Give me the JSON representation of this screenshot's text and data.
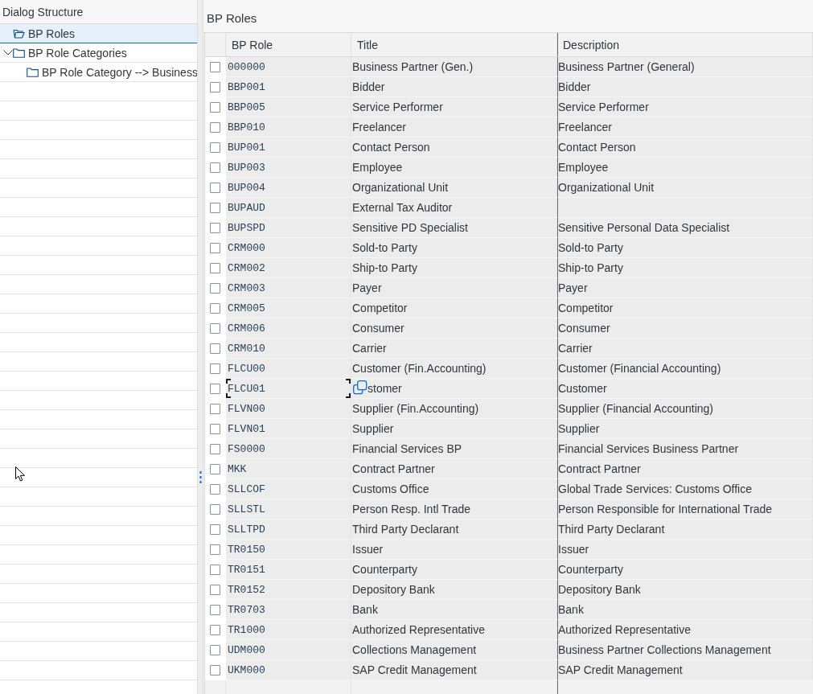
{
  "dialog_structure": {
    "title": "Dialog Structure",
    "items": [
      {
        "label": "BP Roles",
        "selected": true
      },
      {
        "label": "BP Role Categories",
        "selected": false,
        "expanded": true,
        "children": [
          {
            "label": "BP Role Category --> Business",
            "selected": false
          }
        ]
      }
    ]
  },
  "table": {
    "title": "BP Roles",
    "columns": [
      "BP Role",
      "Title",
      "Description"
    ],
    "rows": [
      {
        "role": "000000",
        "title": "Business Partner (Gen.)",
        "description": "Business Partner (General)",
        "selected": false,
        "focused": false
      },
      {
        "role": "BBP001",
        "title": "Bidder",
        "description": "Bidder",
        "selected": false,
        "focused": false
      },
      {
        "role": "BBP005",
        "title": "Service Performer",
        "description": "Service Performer",
        "selected": false,
        "focused": false
      },
      {
        "role": "BBP010",
        "title": "Freelancer",
        "description": "Freelancer",
        "selected": false,
        "focused": false
      },
      {
        "role": "BUP001",
        "title": "Contact Person",
        "description": "Contact Person",
        "selected": false,
        "focused": false
      },
      {
        "role": "BUP003",
        "title": "Employee",
        "description": "Employee",
        "selected": false,
        "focused": false
      },
      {
        "role": "BUP004",
        "title": "Organizational Unit",
        "description": "Organizational Unit",
        "selected": false,
        "focused": false
      },
      {
        "role": "BUPAUD",
        "title": "External Tax Auditor",
        "selected": false,
        "focused": false
      },
      {
        "role": "BUPSPD",
        "title": "Sensitive PD Specialist",
        "description": "Sensitive Personal Data Specialist",
        "selected": false,
        "focused": false
      },
      {
        "role": "CRM000",
        "title": "Sold-to Party",
        "description": "Sold-to Party",
        "selected": false,
        "focused": false
      },
      {
        "role": "CRM002",
        "title": "Ship-to Party",
        "description": "Ship-to Party",
        "selected": false,
        "focused": false
      },
      {
        "role": "CRM003",
        "title": "Payer",
        "description": "Payer",
        "selected": false,
        "focused": false
      },
      {
        "role": "CRM005",
        "title": "Competitor",
        "description": "Competitor",
        "selected": false,
        "focused": false
      },
      {
        "role": "CRM006",
        "title": "Consumer",
        "description": "Consumer",
        "selected": false,
        "focused": false
      },
      {
        "role": "CRM010",
        "title": "Carrier",
        "description": "Carrier",
        "selected": false,
        "focused": false
      },
      {
        "role": "FLCU00",
        "title": "Customer (Fin.Accounting)",
        "description": "Customer (Financial Accounting)",
        "selected": false,
        "focused": false
      },
      {
        "role": "FLCU01",
        "title": "stomer",
        "description": "Customer",
        "selected": false,
        "focused": true
      },
      {
        "role": "FLVN00",
        "title": "Supplier (Fin.Accounting)",
        "description": "Supplier (Financial Accounting)",
        "selected": false,
        "focused": false
      },
      {
        "role": "FLVN01",
        "title": "Supplier",
        "description": "Supplier",
        "selected": false,
        "focused": false
      },
      {
        "role": "FS0000",
        "title": "Financial Services BP",
        "description": "Financial Services Business Partner",
        "selected": false,
        "focused": false
      },
      {
        "role": "MKK",
        "title": "Contract Partner",
        "description": "Contract Partner",
        "selected": false,
        "focused": false
      },
      {
        "role": "SLLCOF",
        "title": "Customs Office",
        "description": "Global Trade Services: Customs Office",
        "selected": false,
        "focused": false
      },
      {
        "role": "SLLSTL",
        "title": "Person Resp. Intl Trade",
        "description": "Person Responsible for International Trade",
        "selected": false,
        "focused": false
      },
      {
        "role": "SLLTPD",
        "title": "Third Party Declarant",
        "description": "Third Party Declarant",
        "selected": false,
        "focused": false
      },
      {
        "role": "TR0150",
        "title": "Issuer",
        "description": "Issuer",
        "selected": false,
        "focused": false
      },
      {
        "role": "TR0151",
        "title": "Counterparty",
        "description": "Counterparty",
        "selected": false,
        "focused": false
      },
      {
        "role": "TR0152",
        "title": "Depository Bank",
        "description": "Depository Bank",
        "selected": false,
        "focused": false
      },
      {
        "role": "TR0703",
        "title": "Bank",
        "description": "Bank",
        "selected": false,
        "focused": false
      },
      {
        "role": "TR1000",
        "title": "Authorized Representative",
        "description": "Authorized Representative",
        "selected": false,
        "focused": false
      },
      {
        "role": "UDM000",
        "title": "Collections Management",
        "description": "Business Partner Collections Management",
        "selected": false,
        "focused": false
      },
      {
        "role": "UKM000",
        "title": "SAP Credit Management",
        "description": "SAP Credit Management",
        "selected": false,
        "focused": false
      }
    ]
  }
}
